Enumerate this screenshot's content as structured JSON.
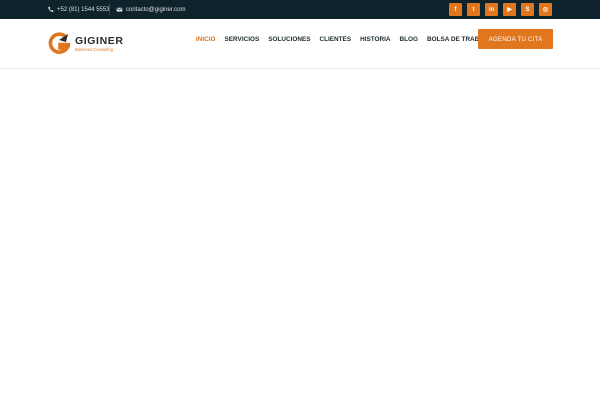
{
  "topbar": {
    "phone": "+52 (81) 1544 5553",
    "email": "contacto@giginer.com",
    "social": [
      {
        "icon": "facebook-icon",
        "glyph": "f"
      },
      {
        "icon": "twitter-icon",
        "glyph": "t"
      },
      {
        "icon": "linkedin-icon",
        "glyph": "in"
      },
      {
        "icon": "youtube-icon",
        "glyph": "▶"
      },
      {
        "icon": "skype-icon",
        "glyph": "S"
      },
      {
        "icon": "instagram-icon",
        "glyph": "◎"
      }
    ]
  },
  "header": {
    "logo_name": "GIGINER",
    "logo_tagline": "Business Consulting",
    "nav": [
      "INICIO",
      "SERVICIOS",
      "SOLUCIONES",
      "CLIENTES",
      "HISTORIA",
      "BLOG",
      "BOLSA DE TRABAJO"
    ],
    "cta_label": "AGENDA TU CITA"
  },
  "colors": {
    "topbar_bg": "#0f232c",
    "accent": "#e0771f",
    "nav_text": "#1e2a30"
  }
}
